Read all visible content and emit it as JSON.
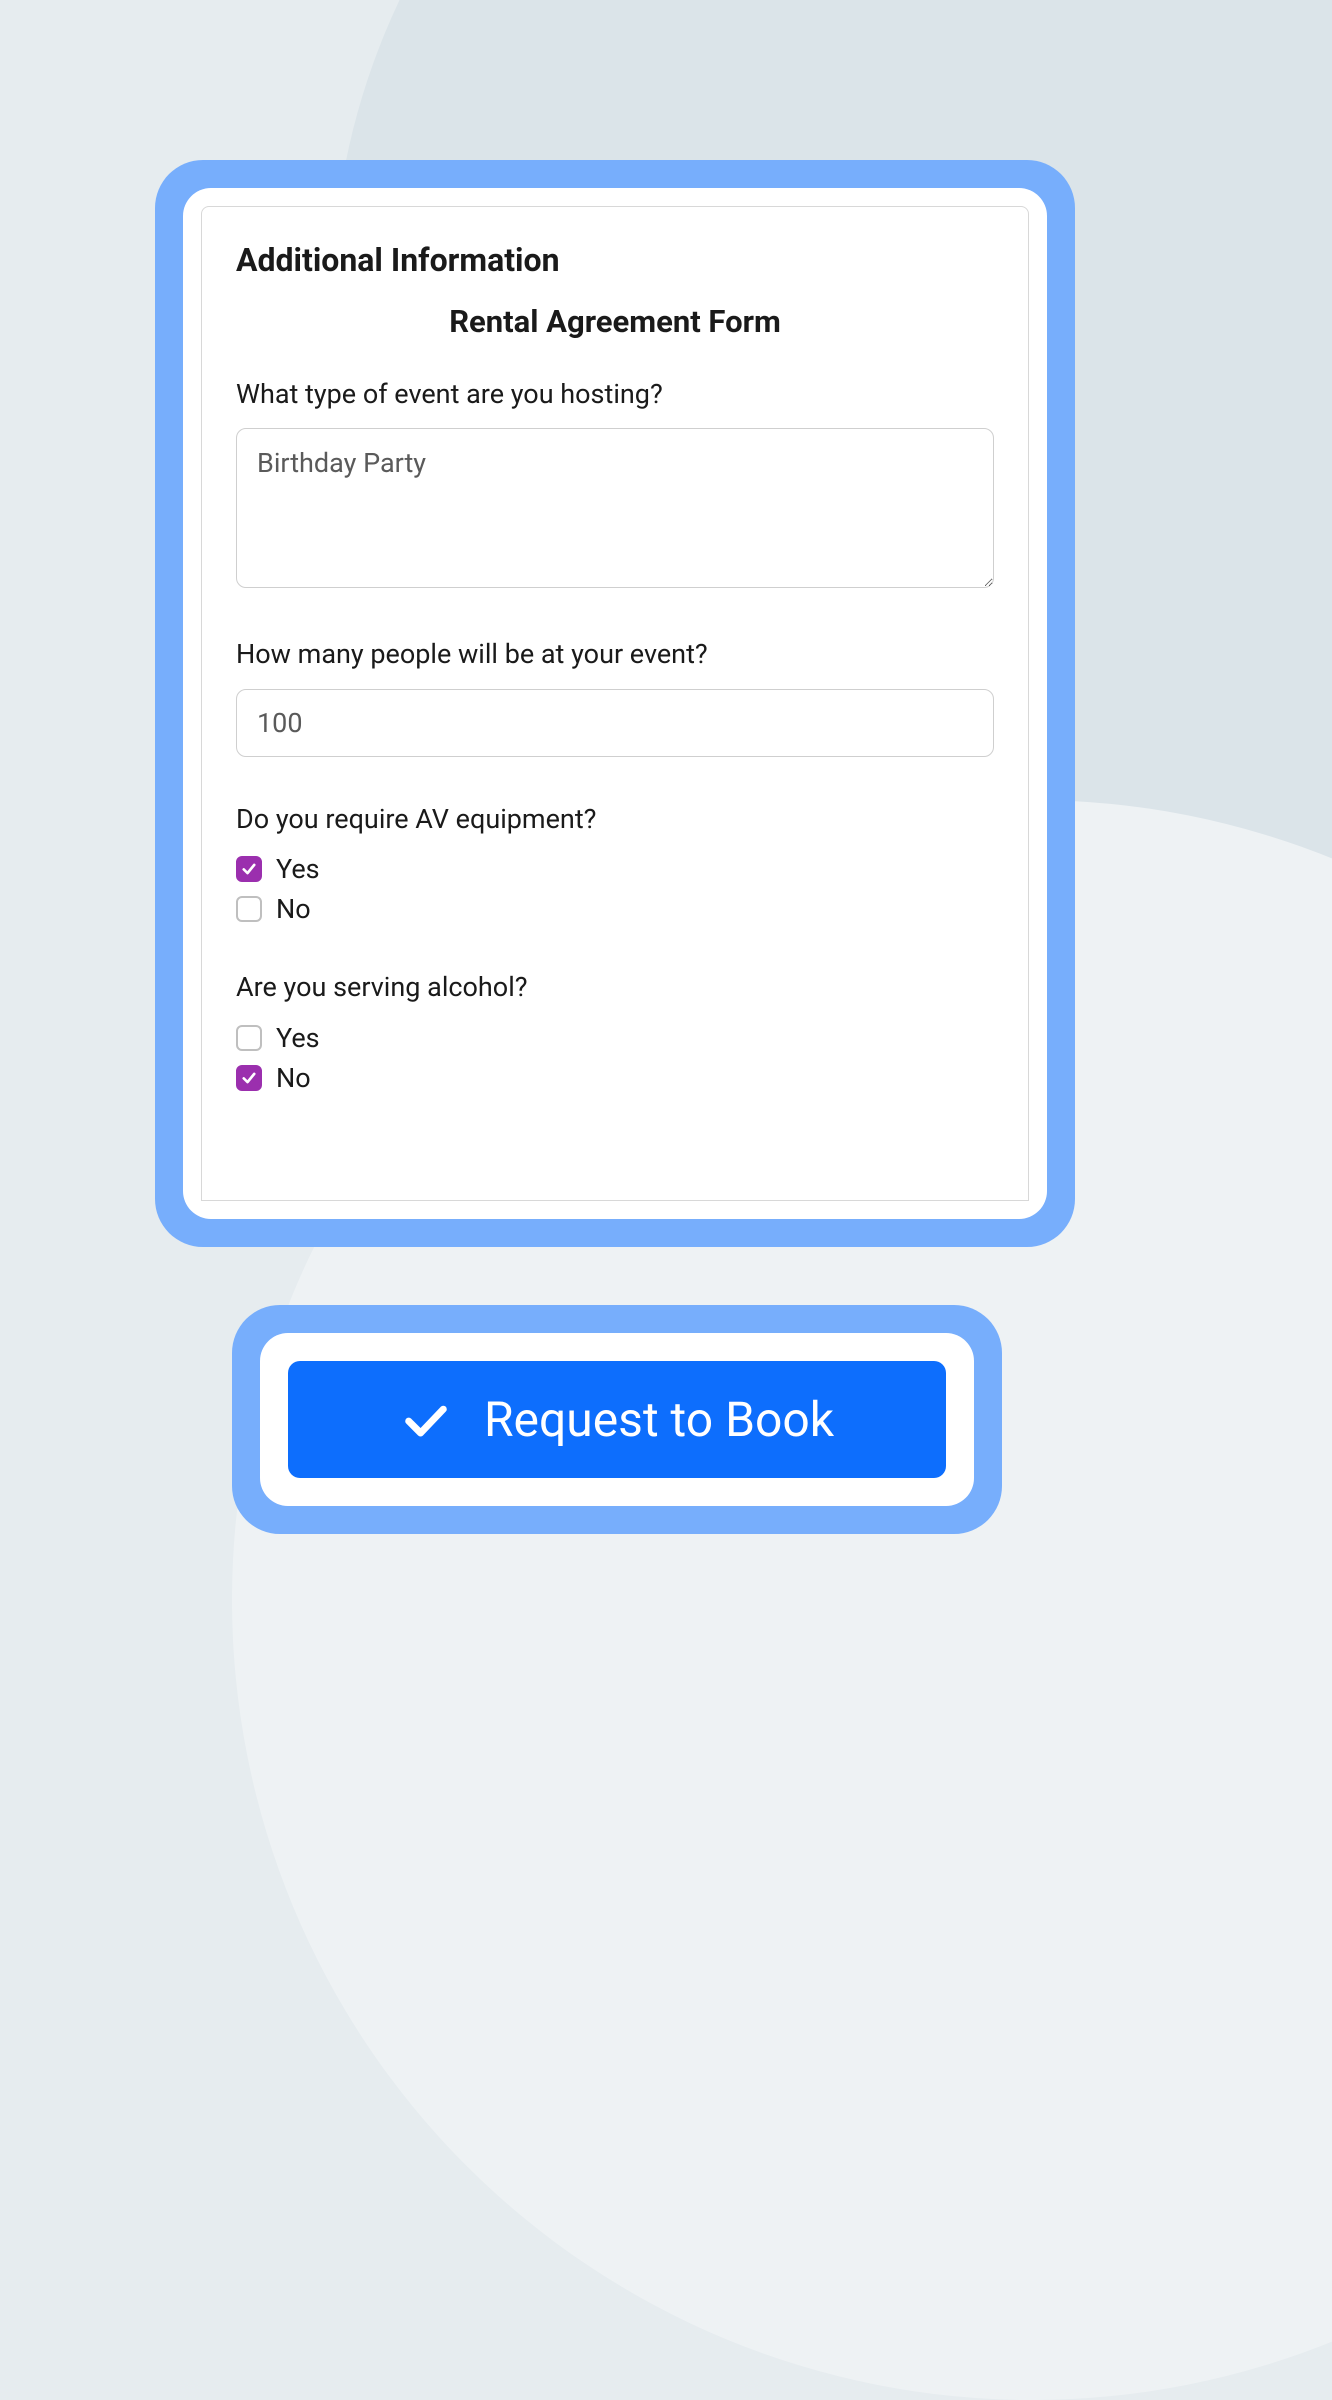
{
  "form": {
    "section_heading": "Additional Information",
    "title": "Rental Agreement Form",
    "q_event_type": {
      "label": "What type of event are you hosting?",
      "value": "Birthday Party"
    },
    "q_people": {
      "label": "How many people will be at your event?",
      "value": "100"
    },
    "q_av": {
      "label": "Do you require AV equipment?",
      "opt_yes": "Yes",
      "opt_no": "No",
      "yes_checked": true,
      "no_checked": false
    },
    "q_alcohol": {
      "label": "Are you serving alcohol?",
      "opt_yes": "Yes",
      "opt_no": "No",
      "yes_checked": false,
      "no_checked": true
    }
  },
  "cta": {
    "label": "Request to Book"
  },
  "colors": {
    "accent_border": "#77aefc",
    "primary_button": "#0d6efd",
    "checkbox_checked": "#9b2fae"
  }
}
